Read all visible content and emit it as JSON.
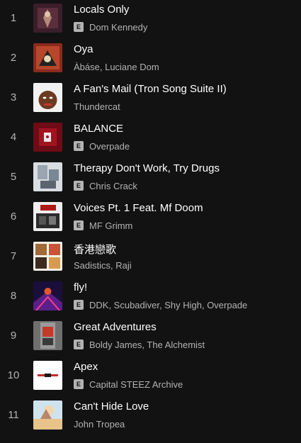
{
  "explicit_label": "E",
  "tracks": [
    {
      "number": "1",
      "title": "Locals Only",
      "artists": "Dom Kennedy",
      "explicit": true,
      "art": "locals-only-cover-art"
    },
    {
      "number": "2",
      "title": "Oya",
      "artists": "Àbáse, Luciane Dom",
      "explicit": false,
      "art": "oya-cover-art"
    },
    {
      "number": "3",
      "title": "A Fan's Mail (Tron Song Suite II)",
      "artists": "Thundercat",
      "explicit": false,
      "art": "drunk-cover-art"
    },
    {
      "number": "4",
      "title": "BALANCE",
      "artists": "Overpade",
      "explicit": true,
      "art": "balance-cover-art"
    },
    {
      "number": "5",
      "title": "Therapy Don't Work, Try Drugs",
      "artists": "Chris Crack",
      "explicit": true,
      "art": "therapy-cover-art"
    },
    {
      "number": "6",
      "title": "Voices Pt. 1 Feat. Mf Doom",
      "artists": "MF Grimm",
      "explicit": true,
      "art": "voices-cover-art"
    },
    {
      "number": "7",
      "title": "香港戀歌",
      "artists": "Sadistics, Raji",
      "explicit": false,
      "art": "hong-kong-cover-art"
    },
    {
      "number": "8",
      "title": "fly!",
      "artists": "DDK, Scubadiver, Shy High, Overpade",
      "explicit": true,
      "art": "fly-cover-art"
    },
    {
      "number": "9",
      "title": "Great Adventures",
      "artists": "Boldy James, The Alchemist",
      "explicit": true,
      "art": "great-adventures-cover-art"
    },
    {
      "number": "10",
      "title": "Apex",
      "artists": "Capital STEEZ Archive",
      "explicit": true,
      "art": "apex-cover-art"
    },
    {
      "number": "11",
      "title": "Can't Hide Love",
      "artists": "John Tropea",
      "explicit": false,
      "art": "cant-hide-love-cover-art"
    }
  ]
}
